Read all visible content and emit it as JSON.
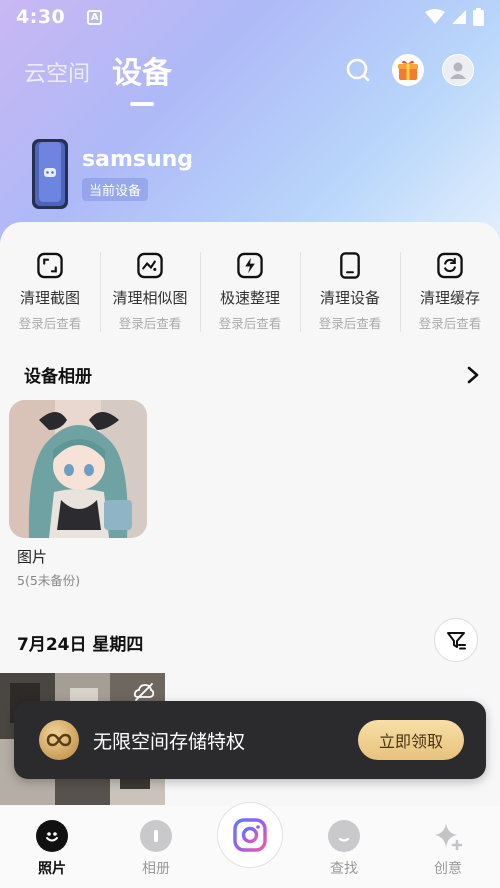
{
  "status": {
    "time": "4:30",
    "notification_badge": "A"
  },
  "header": {
    "tabs": [
      {
        "label": "云空间"
      },
      {
        "label": "设备"
      }
    ],
    "icons": [
      "search-icon",
      "gift-box-icon",
      "avatar-icon"
    ]
  },
  "device": {
    "name": "samsung",
    "tag": "当前设备"
  },
  "tools": [
    {
      "label": "清理截图",
      "sub": "登录后查看",
      "icon": "screenshot-icon"
    },
    {
      "label": "清理相似图",
      "sub": "登录后查看",
      "icon": "similar-image-icon"
    },
    {
      "label": "极速整理",
      "sub": "登录后查看",
      "icon": "fast-organize-icon"
    },
    {
      "label": "清理设备",
      "sub": "登录后查看",
      "icon": "phone-clean-icon"
    },
    {
      "label": "清理缓存",
      "sub": "登录后查看",
      "icon": "cache-clean-icon"
    }
  ],
  "albums_section": {
    "title": "设备相册"
  },
  "album": {
    "name": "图片",
    "count": "5(5未备份)"
  },
  "timeline": {
    "date": "7月24日 星期四"
  },
  "promo": {
    "text": "无限空间存储特权",
    "button": "立即领取"
  },
  "bottom_nav": [
    {
      "label": "照片",
      "active": true
    },
    {
      "label": "相册",
      "active": false
    },
    {
      "label": "查找",
      "active": false
    },
    {
      "label": "创意",
      "active": false
    }
  ],
  "colors": {
    "accent": "#111111",
    "promo_bg": "#2b2b2d",
    "promo_button": "#f0d090"
  }
}
